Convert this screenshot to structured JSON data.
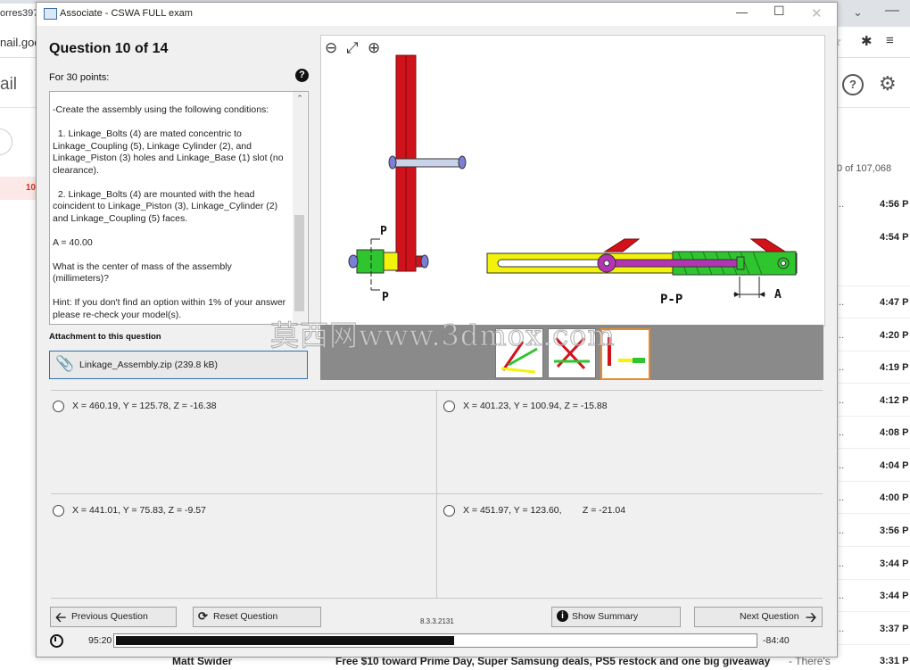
{
  "background": {
    "tab_text": "orres397",
    "url_text": "nail.goo",
    "brand_text": "ail",
    "badge_text": "10",
    "count_text": "0 of 107,068",
    "times": [
      "4:56 P",
      "4:54 P",
      "4:47 P",
      "4:20 P",
      "4:19 P",
      "4:12 P",
      "4:08 P",
      "4:04 P",
      "4:00 P",
      "3:56 P",
      "3:44 P",
      "3:44 P",
      "3:37 P",
      "3:31 P"
    ],
    "bottom_sender": "Matt Swider",
    "bottom_subject": "Free $10 toward Prime Day, Super Samsung deals, PS5 restock and one big giveaway",
    "bottom_snippet": "- There's"
  },
  "window": {
    "title": "Associate - CSWA FULL exam"
  },
  "question": {
    "title": "Question 10 of 14",
    "points": "For 30 points:",
    "paragraphs": [
      "-Create the assembly using the following conditions:",
      "  1. Linkage_Bolts (4) are mated concentric to Linkage_Coupling (5), Linkage Cylinder (2), and Linkage_Piston (3) holes and Linkage_Base (1) slot (no clearance).",
      "  2. Linkage_Bolts (4) are mounted with the head coincident to Linkage_Piston (3), Linkage_Cylinder (2) and Linkage_Coupling (5) faces.",
      "A = 40.00",
      "What is the center of mass of the assembly (millimeters)?",
      "Hint: If you don't find an option within 1% of your answer please re-check your model(s)."
    ],
    "attachment_label": "Attachment to this question",
    "attachment_file": "Linkage_Assembly.zip (239.8 kB)"
  },
  "figure": {
    "label_p_top": "P",
    "label_p_bottom": "P",
    "label_section": "P-P",
    "label_a": "A",
    "watermark": "莫西网www.3dmox.com"
  },
  "answers": [
    {
      "text": "X = 460.19, Y = 125.78, Z = -16.38"
    },
    {
      "text": "X = 401.23, Y = 100.94, Z = -15.88"
    },
    {
      "text": "X = 441.01, Y = 75.83, Z = -9.57"
    },
    {
      "text": "X = 451.97, Y = 123.60,        Z = -21.04"
    }
  ],
  "footer": {
    "previous": "Previous Question",
    "reset": "Reset Question",
    "version": "8.3.3.2131",
    "summary": "Show Summary",
    "next": "Next Question",
    "time_elapsed": "95:20",
    "time_remaining": "-84:40",
    "progress_fraction": 0.53
  },
  "colors": {
    "cylinder_red": "#d0121b",
    "piston_green": "#2ec52e",
    "base_yellow": "#f2f20a",
    "coupling_purple": "#b534b5",
    "thumb_selected": "#e88a2a"
  }
}
